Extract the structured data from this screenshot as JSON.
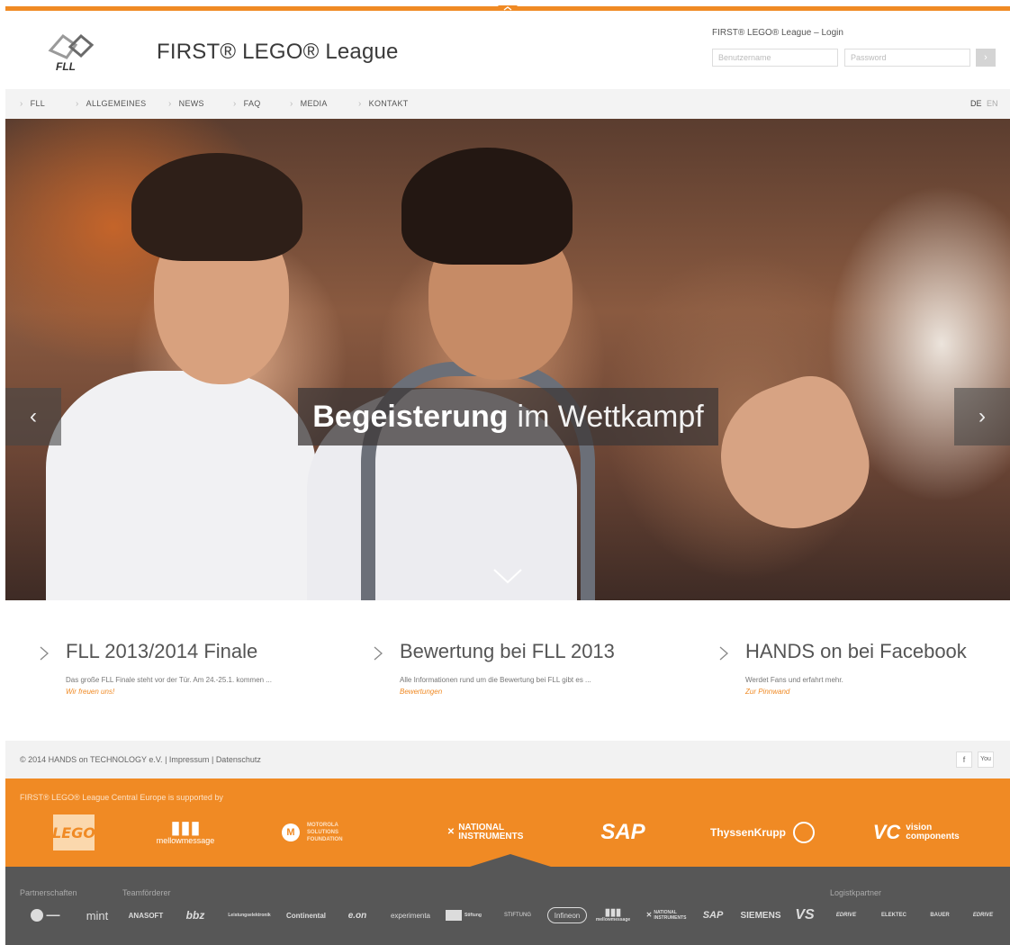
{
  "header": {
    "brand_text": "FIRST® LEGO® League",
    "logo_text": "FLL"
  },
  "login": {
    "title": "FIRST® LEGO® League – Login",
    "username_placeholder": "Benutzername",
    "password_placeholder": "Password",
    "submit_icon": "chevron-right-icon"
  },
  "nav": {
    "items": [
      {
        "label": "FLL"
      },
      {
        "label": "ALLGEMEINES"
      },
      {
        "label": "NEWS"
      },
      {
        "label": "FAQ"
      },
      {
        "label": "MEDIA"
      },
      {
        "label": "KONTAKT"
      }
    ],
    "lang_active": "DE",
    "lang_other": "EN"
  },
  "hero": {
    "caption_strong": "Begeisterung",
    "caption_light": "im Wettkampf",
    "prev_symbol": "‹",
    "next_symbol": "›"
  },
  "teasers": [
    {
      "title": "FLL 2013/2014 Finale",
      "text": "Das große FLL Finale steht vor der Tür. Am 24.-25.1. kommen ...",
      "link": "Wir freuen uns!"
    },
    {
      "title": "Bewertung bei FLL 2013",
      "text": "Alle Informationen rund um die Bewertung bei FLL gibt es ...",
      "link": "Bewertungen"
    },
    {
      "title": "HANDS on bei Facebook",
      "text": "Werdet Fans und erfahrt mehr.",
      "link": "Zur Pinnwand"
    }
  ],
  "footer": {
    "copyright": "© 2014 HANDS on TECHNOLOGY e.V.",
    "impressum": "Impressum",
    "datenschutz": "Datenschutz",
    "separator": "|",
    "facebook": "f",
    "youtube": "You"
  },
  "sponsors": {
    "title": "FIRST® LEGO® League Central Europe is supported by",
    "items": [
      {
        "name": "LEGO"
      },
      {
        "name": "mellowmessage"
      },
      {
        "name": "MOTOROLA SOLUTIONS FOUNDATION"
      },
      {
        "name": "NATIONAL INSTRUMENTS"
      },
      {
        "name": "SAP"
      },
      {
        "name": "ThyssenKrupp"
      },
      {
        "name": "vision components"
      }
    ]
  },
  "partners": {
    "label_partnerschaften": "Partnerschaften",
    "label_teamfoerderer": "Teamförderer",
    "label_logistik": "Logistkpartner",
    "items": [
      {
        "name": "mint"
      },
      {
        "name": "ANASOFT"
      },
      {
        "name": "bbz"
      },
      {
        "name": "Leistungselektronik"
      },
      {
        "name": "Continental"
      },
      {
        "name": "e.on"
      },
      {
        "name": "experimenta"
      },
      {
        "name": "Stiftung"
      },
      {
        "name": "STIFTUNG"
      },
      {
        "name": "Infineon"
      },
      {
        "name": "mellowmessage"
      },
      {
        "name": "NATIONAL INSTRUMENTS"
      },
      {
        "name": "SAP"
      },
      {
        "name": "SIEMENS"
      },
      {
        "name": "VS"
      },
      {
        "name": "EDRIVE"
      },
      {
        "name": "ELEKTEC"
      },
      {
        "name": "BAUER"
      },
      {
        "name": "EDRIVE"
      }
    ]
  },
  "colors": {
    "accent": "#f08a24",
    "nav_bg": "#f3f3f3",
    "partner_bg": "#575757"
  }
}
